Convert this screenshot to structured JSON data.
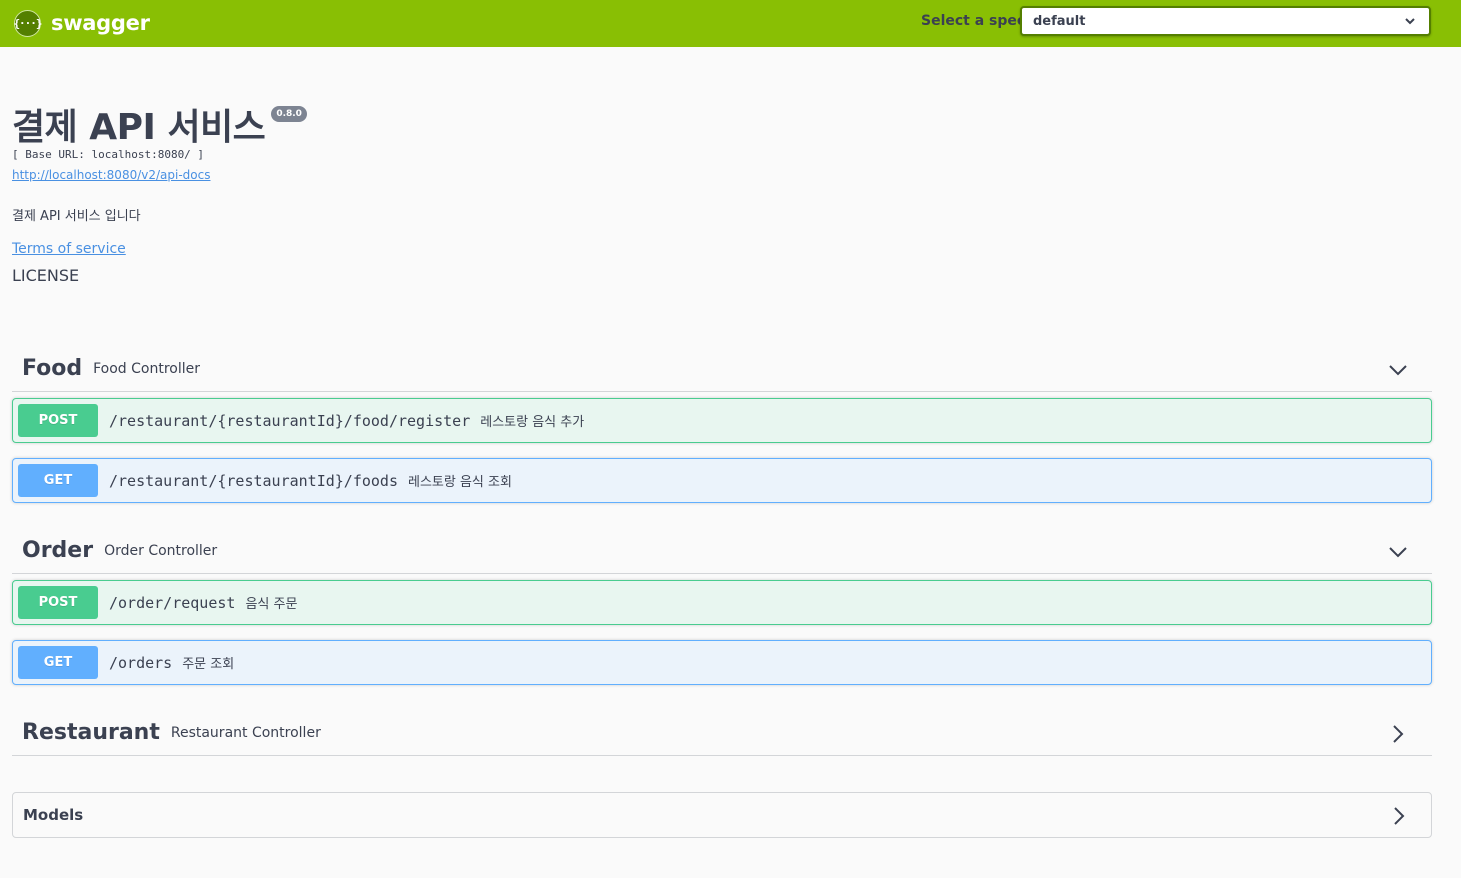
{
  "topbar": {
    "logo_icon": "{···}",
    "logo_text": "swagger",
    "spec_label": "Select a spec",
    "spec_value": "default",
    "brand_color": "#89bf04"
  },
  "info": {
    "title": "결제 API 서비스",
    "version": "0.8.0",
    "base_url": "[ Base URL: localhost:8080/ ]",
    "api_docs_link": "http://localhost:8080/v2/api-docs",
    "description": "결제 API 서비스 입니다",
    "terms_of_service": "Terms of service",
    "license": "LICENSE"
  },
  "tags": [
    {
      "name": "Food",
      "description": "Food Controller",
      "expanded": true,
      "operations": [
        {
          "method": "POST",
          "path": "/restaurant/{restaurantId}/food/register",
          "summary": "레스토랑 음식 추가"
        },
        {
          "method": "GET",
          "path": "/restaurant/{restaurantId}/foods",
          "summary": "레스토랑 음식 조회"
        }
      ]
    },
    {
      "name": "Order",
      "description": "Order Controller",
      "expanded": true,
      "operations": [
        {
          "method": "POST",
          "path": "/order/request",
          "summary": "음식 주문"
        },
        {
          "method": "GET",
          "path": "/orders",
          "summary": "주문 조회"
        }
      ]
    },
    {
      "name": "Restaurant",
      "description": "Restaurant Controller",
      "expanded": false,
      "operations": []
    }
  ],
  "models": {
    "title": "Models",
    "expanded": false
  },
  "colors": {
    "post": "#49cc90",
    "get": "#61affe",
    "link": "#4990e2",
    "text": "#3b4151"
  }
}
